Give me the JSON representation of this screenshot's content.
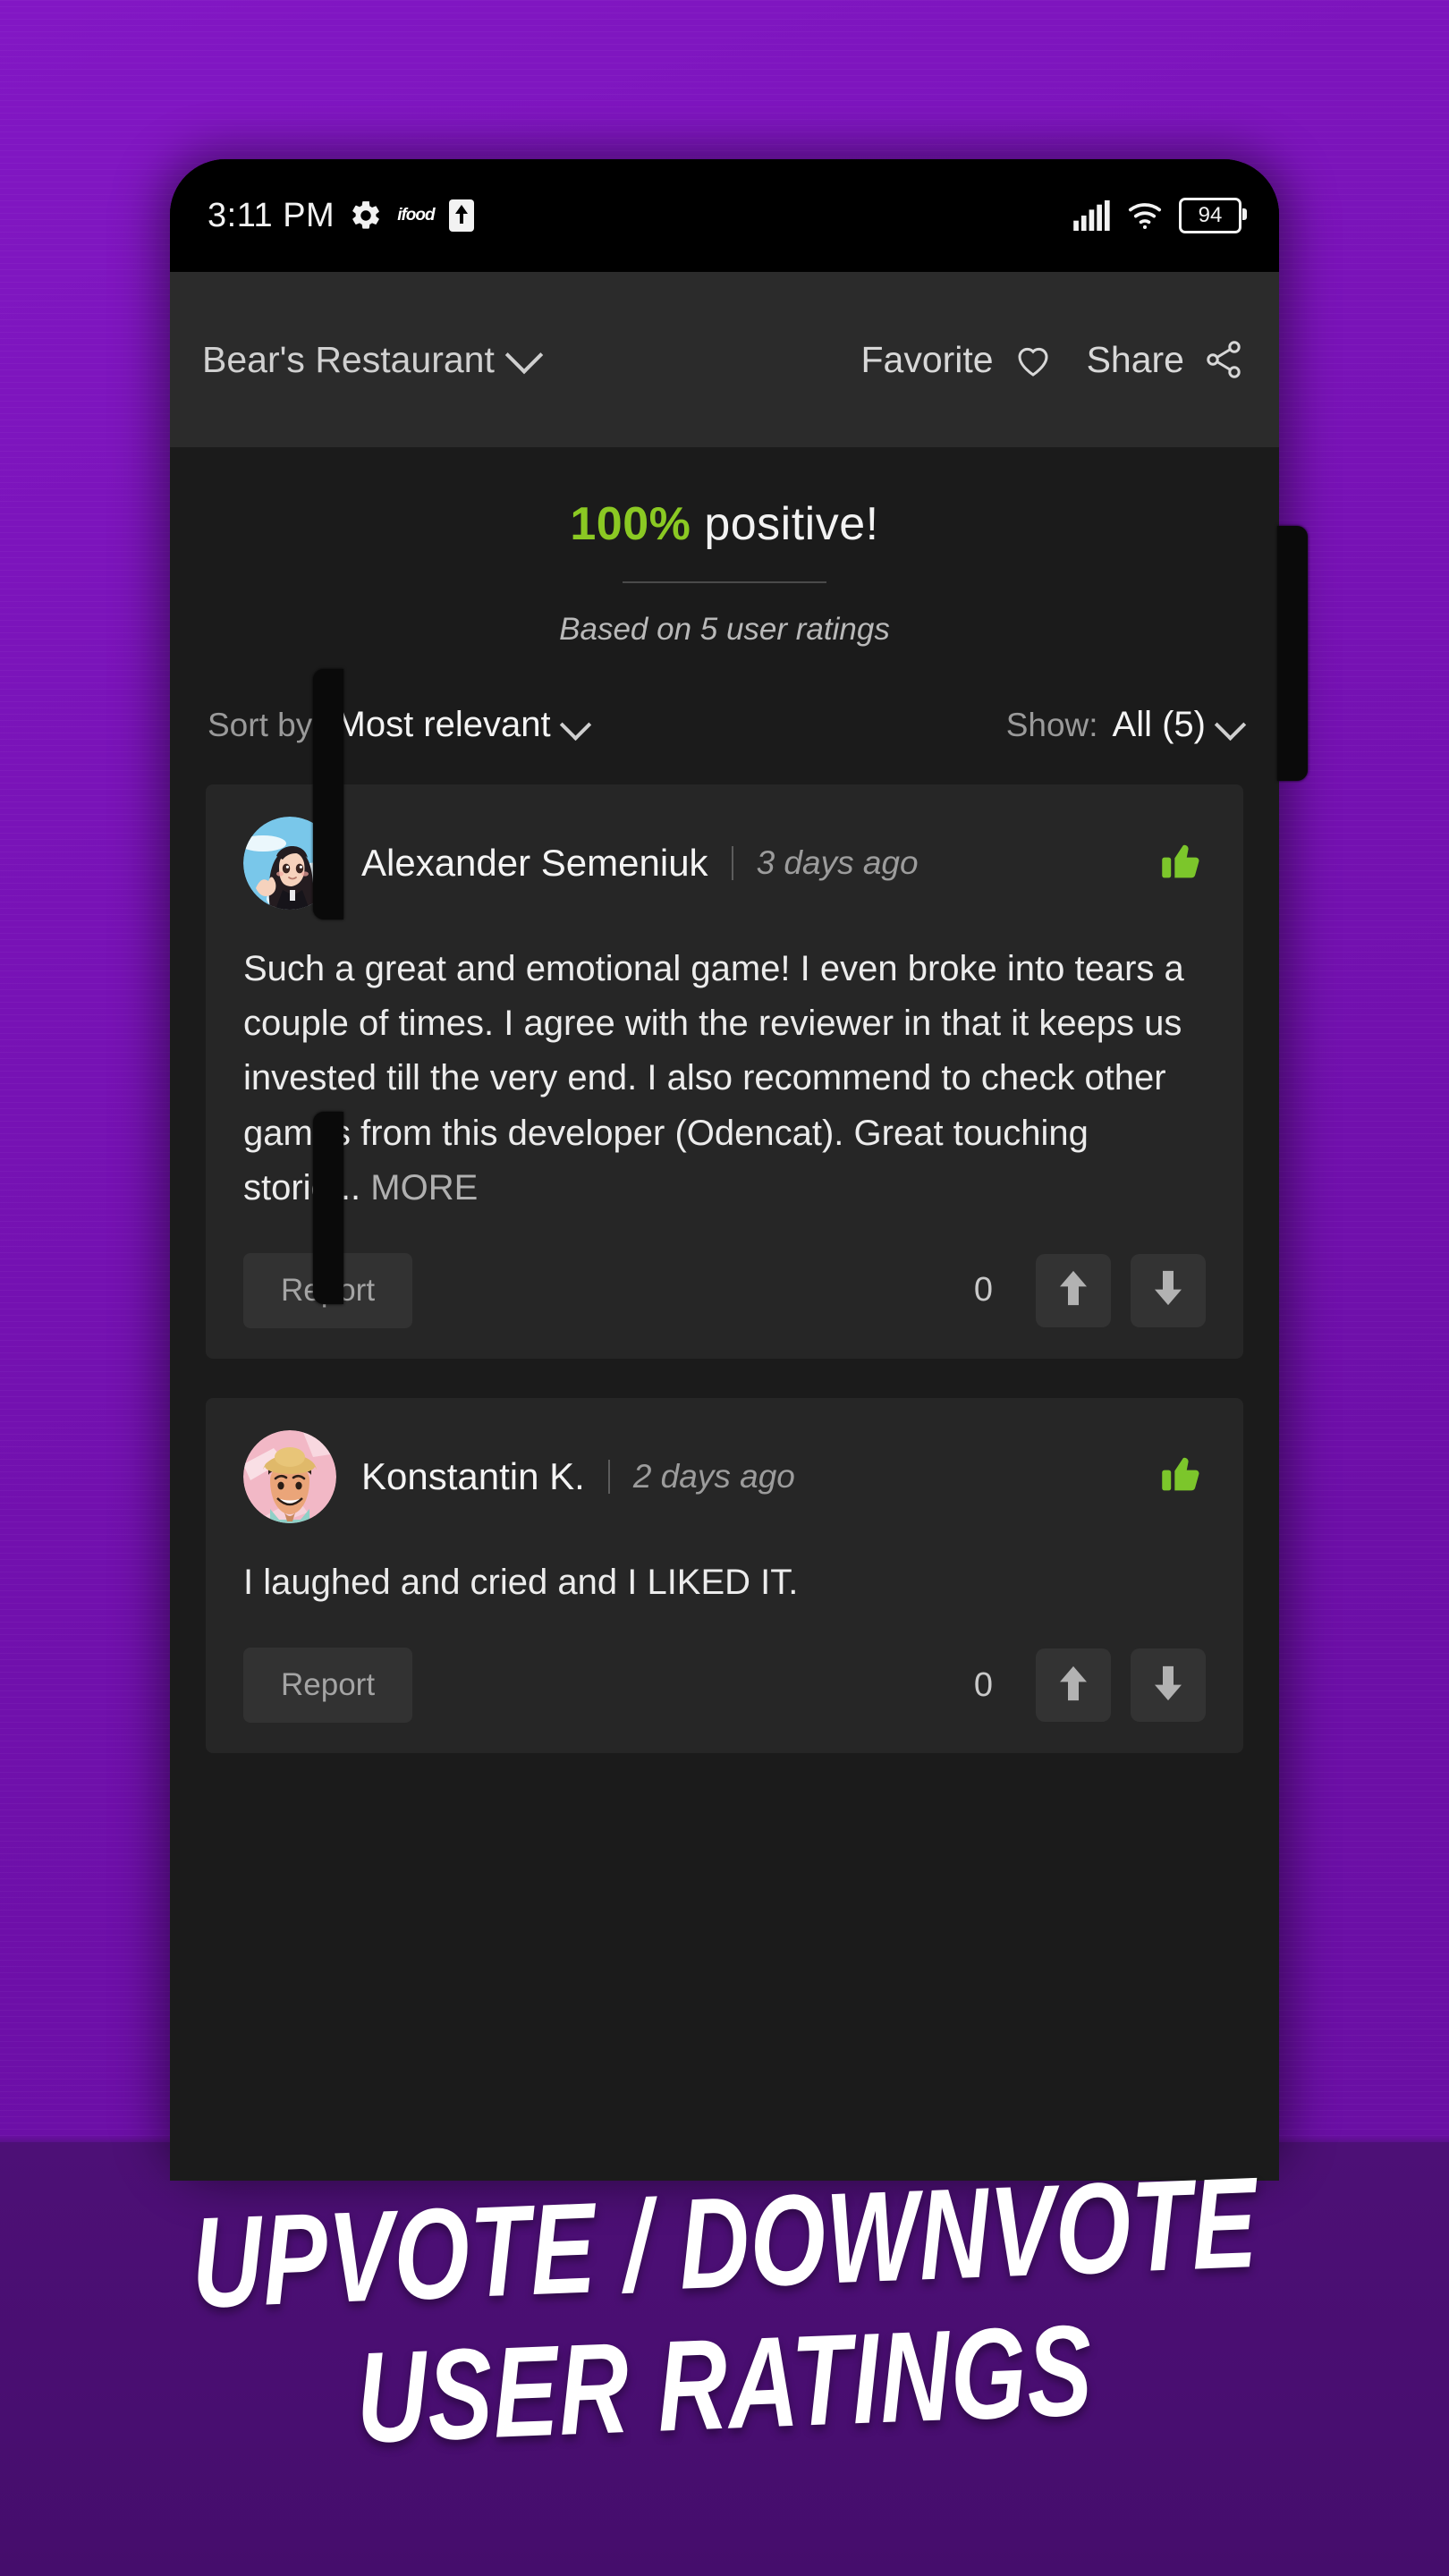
{
  "promo": {
    "caption_line_1": "UPVOTE / DOWNVOTE",
    "caption_line_2": "USER RATINGS",
    "background_color": "#7712b5",
    "footer_color": "#4d1076"
  },
  "status_bar": {
    "time": "3:11 PM",
    "icons": [
      "gear-icon",
      "ifood-icon",
      "upload-icon"
    ],
    "ifood_label": "ifood",
    "signal_icon": "signal-bars-icon",
    "wifi_icon": "wifi-icon",
    "battery_level": "94"
  },
  "app_bar": {
    "title": "Bear's Restaurant",
    "title_chevron": "chevron-down-icon",
    "favorite_label": "Favorite",
    "favorite_icon": "heart-outline-icon",
    "share_label": "Share",
    "share_icon": "share-icon"
  },
  "rating_summary": {
    "percent": "100%",
    "percent_color": "#8bc923",
    "word": " positive!",
    "subtitle": "Based on 5 user ratings"
  },
  "filters": {
    "sort_label": "Sort by:",
    "sort_value": "Most relevant",
    "show_label": "Show:",
    "show_value": "All (5)"
  },
  "reviews": [
    {
      "author": "Alexander Semeniuk",
      "date": "3 days ago",
      "sentiment_icon": "thumbs-up-icon",
      "sentiment_color": "#7cc62b",
      "avatar": "anime-girl-avatar",
      "text": "Such a great and emotional game! I even broke into tears a couple of times. I agree with the reviewer in that it keeps us invested till the very end. I also recommend to check other games from this developer (Odencat). Great touching storie...",
      "more_label": "MORE",
      "report_label": "Report",
      "vote_count": "0",
      "upvote_icon": "arrow-up-icon",
      "downvote_icon": "arrow-down-icon"
    },
    {
      "author": "Konstantin K.",
      "date": "2 days ago",
      "sentiment_icon": "thumbs-up-icon",
      "sentiment_color": "#7cc62b",
      "avatar": "cartoon-man-straw-hat-avatar",
      "text": "I laughed and cried and I LIKED IT.",
      "more_label": "",
      "report_label": "Report",
      "vote_count": "0",
      "upvote_icon": "arrow-up-icon",
      "downvote_icon": "arrow-down-icon"
    }
  ]
}
